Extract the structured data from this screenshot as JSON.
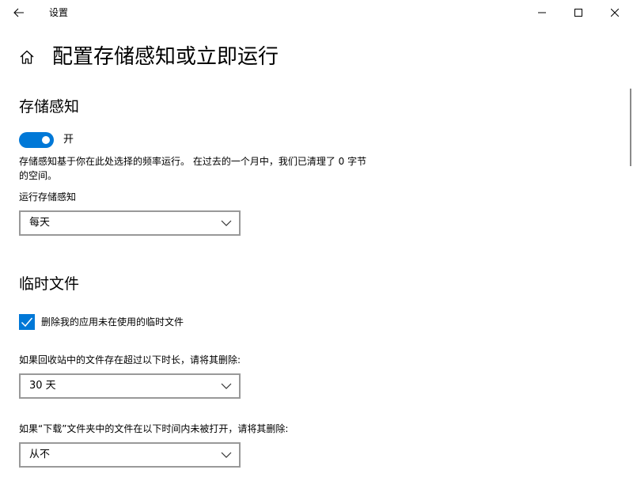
{
  "window": {
    "title": "设置"
  },
  "page": {
    "title": "配置存储感知或立即运行"
  },
  "storage_sense": {
    "section_title": "存储感知",
    "toggle_state": "开",
    "toggle_on": true,
    "description": "存储感知基于你在此处选择的频率运行。 在过去的一个月中，我们已清理了 0 字节 的空间。",
    "run_label": "运行存储感知",
    "run_value": "每天"
  },
  "temp_files": {
    "section_title": "临时文件",
    "delete_unused_label": "删除我的应用未在使用的临时文件",
    "delete_unused_checked": true,
    "recycle_label": "如果回收站中的文件存在超过以下时长，请将其删除:",
    "recycle_value": "30 天",
    "downloads_label": "如果“下载”文件夹中的文件在以下时间内未被打开，请将其删除:",
    "downloads_value": "从不"
  },
  "colors": {
    "accent": "#0078d7",
    "border": "#999999"
  },
  "icons": {
    "back": "back-arrow-icon",
    "minimize": "minimize-icon",
    "maximize": "maximize-icon",
    "close": "close-icon",
    "home": "home-icon",
    "chevron": "chevron-down-icon",
    "check": "check-icon"
  }
}
